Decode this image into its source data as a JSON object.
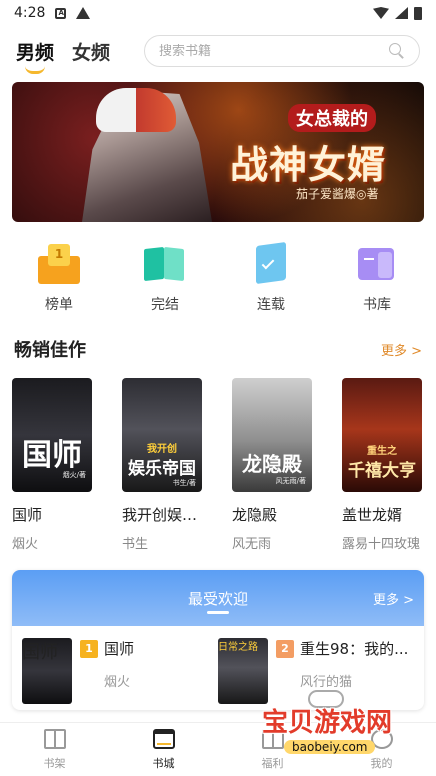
{
  "status": {
    "time": "4:28"
  },
  "top_tabs": [
    {
      "label": "男频",
      "active": true
    },
    {
      "label": "女频",
      "active": false
    }
  ],
  "search": {
    "placeholder": "搜索书籍"
  },
  "banner": {
    "kicker": "女总裁的",
    "title": "战神女婿",
    "author": "茄子爱酱爆◎著"
  },
  "categories": [
    {
      "label": "榜单",
      "icon": "ranking-icon"
    },
    {
      "label": "完结",
      "icon": "open-book-icon"
    },
    {
      "label": "连载",
      "icon": "serial-book-icon"
    },
    {
      "label": "书库",
      "icon": "library-icon"
    }
  ],
  "bestsellers": {
    "title": "畅销佳作",
    "more": "更多 >",
    "books": [
      {
        "name": "国师",
        "author": "烟火",
        "cover_title": "国师",
        "cover_author": "烟火/著"
      },
      {
        "name": "我开创娱乐帝国",
        "author": "书生",
        "cover_title": "娱乐帝国",
        "cover_kicker": "我开创",
        "cover_author": "书生/著"
      },
      {
        "name": "龙隐殿",
        "author": "风无雨",
        "cover_title": "龙隐殿",
        "cover_author": "风无雨/著"
      },
      {
        "name": "盖世龙婿",
        "author": "露易十四玫瑰",
        "cover_title": "千禧大亨",
        "cover_kicker": "重生之",
        "cover_author": ""
      }
    ]
  },
  "popular": {
    "title": "最受欢迎",
    "more": "更多 >",
    "items": [
      {
        "rank": "1",
        "name": "国师",
        "author": "烟火",
        "cover_title": "国师"
      },
      {
        "rank": "2",
        "name": "重生98：我的...",
        "author": "风行的猫",
        "cover_title": "日常之路"
      }
    ]
  },
  "bottom_nav": [
    {
      "label": "书架",
      "active": false
    },
    {
      "label": "书城",
      "active": true
    },
    {
      "label": "福利",
      "active": false
    },
    {
      "label": "我的",
      "active": false
    }
  ],
  "watermark": {
    "title": "宝贝游戏网",
    "url": "baobeiy.com"
  }
}
